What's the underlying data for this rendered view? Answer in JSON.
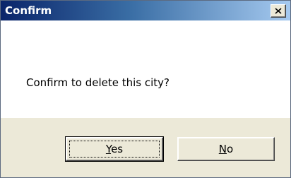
{
  "window": {
    "title": "Confirm",
    "close_icon": "close-icon"
  },
  "message": "Confirm to delete this city?",
  "buttons": {
    "yes": {
      "mnemonic": "Y",
      "rest": "es"
    },
    "no": {
      "mnemonic": "N",
      "rest": "o"
    }
  }
}
